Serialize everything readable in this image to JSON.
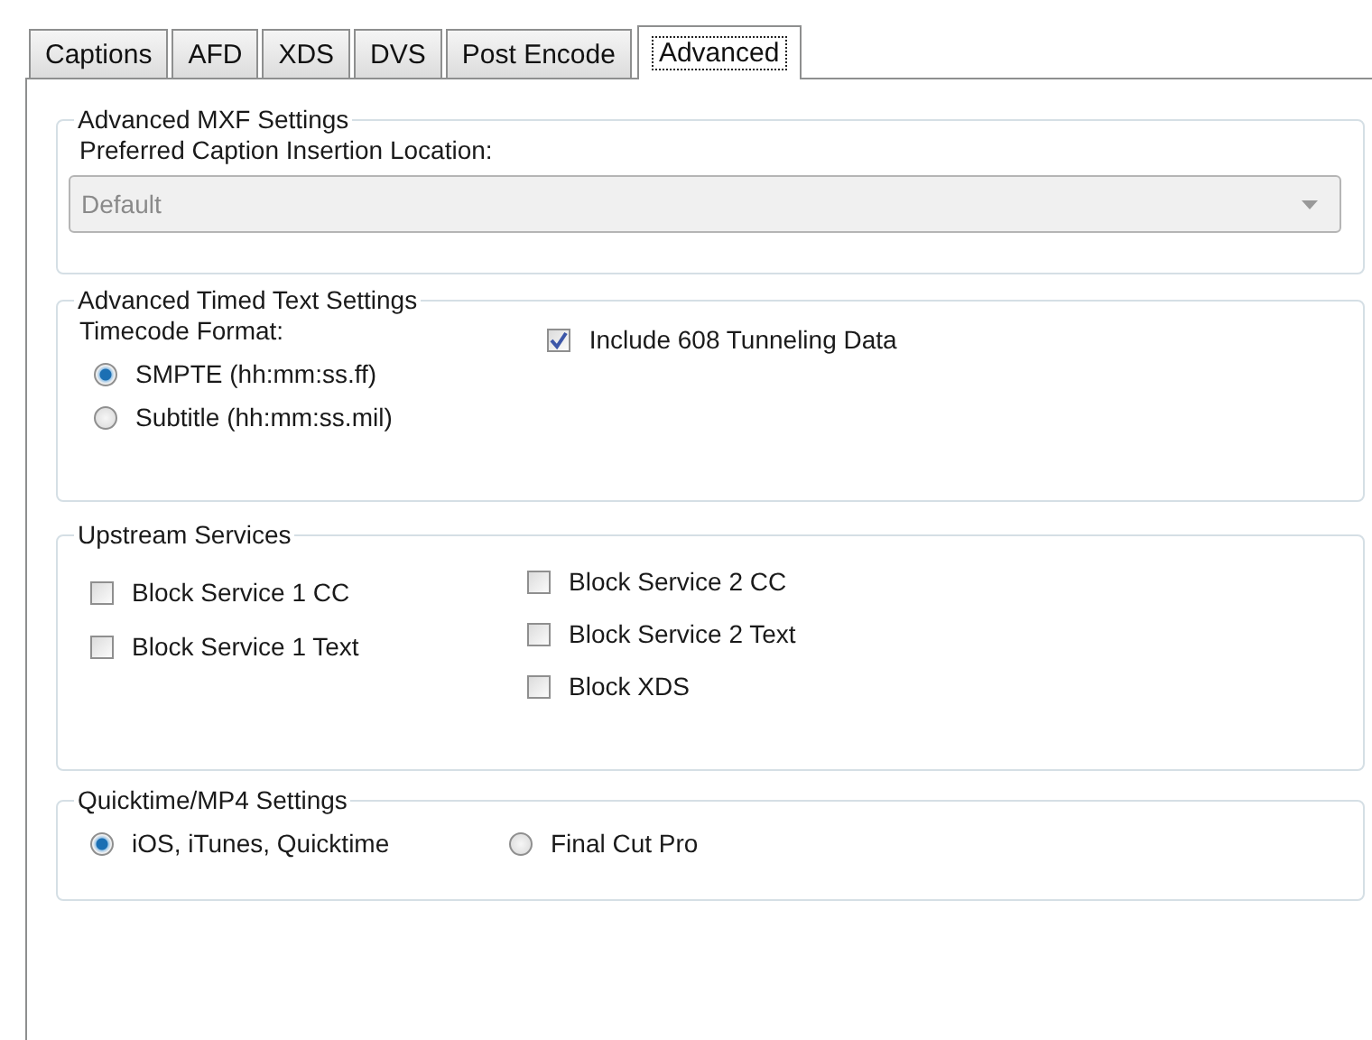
{
  "tabs": [
    {
      "label": "Captions",
      "selected": false
    },
    {
      "label": "AFD",
      "selected": false
    },
    {
      "label": "XDS",
      "selected": false
    },
    {
      "label": "DVS",
      "selected": false
    },
    {
      "label": "Post Encode",
      "selected": false
    },
    {
      "label": "Advanced",
      "selected": true
    }
  ],
  "mxf": {
    "title": "Advanced MXF Settings",
    "label": "Preferred Caption Insertion Location:",
    "dropdown": {
      "value": "Default",
      "disabled": true
    }
  },
  "timed_text": {
    "title": "Advanced Timed Text Settings",
    "label": "Timecode Format:",
    "radios": [
      {
        "label": "SMPTE (hh:mm:ss.ff)",
        "selected": true
      },
      {
        "label": "Subtitle (hh:mm:ss.mil)",
        "selected": false
      }
    ],
    "checkbox": {
      "label": "Include 608 Tunneling Data",
      "checked": true
    }
  },
  "upstream": {
    "title": "Upstream Services",
    "columns": [
      [
        {
          "label": "Block Service 1 CC",
          "checked": false
        },
        {
          "label": "Block Service 1 Text",
          "checked": false
        }
      ],
      [
        {
          "label": "Block Service 2 CC",
          "checked": false
        },
        {
          "label": "Block Service 2 Text",
          "checked": false
        },
        {
          "label": "Block XDS",
          "checked": false
        }
      ]
    ]
  },
  "quicktime": {
    "title": "Quicktime/MP4 Settings",
    "radios": [
      {
        "label": "iOS, iTunes, Quicktime",
        "selected": true
      },
      {
        "label": "Final Cut Pro",
        "selected": false
      }
    ]
  }
}
